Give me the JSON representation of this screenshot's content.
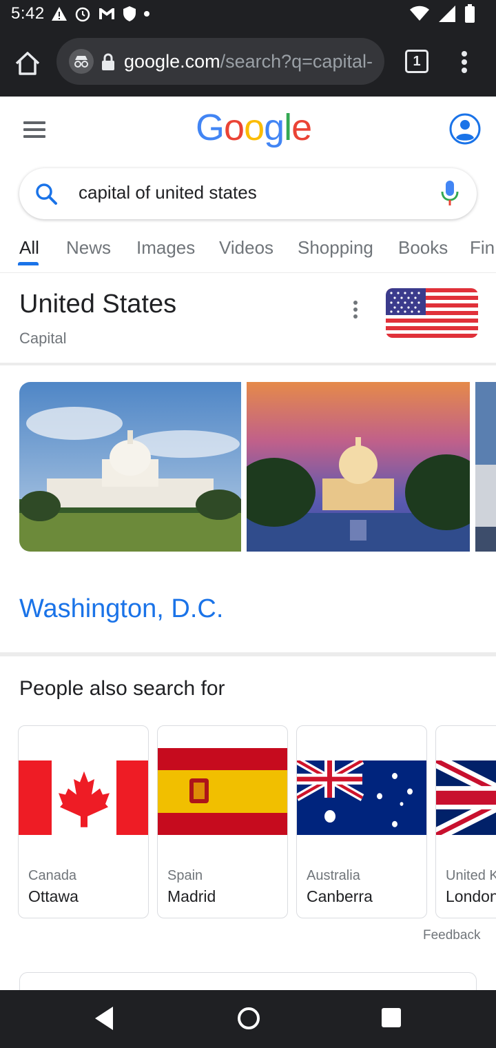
{
  "status_bar": {
    "time": "5:42"
  },
  "browser": {
    "url_main": "google.com",
    "url_path": "/search?q=capital-",
    "tab_count": "1"
  },
  "google": {
    "logo_letters": [
      {
        "ch": "G",
        "color": "#4285F4"
      },
      {
        "ch": "o",
        "color": "#EA4335"
      },
      {
        "ch": "o",
        "color": "#FBBC05"
      },
      {
        "ch": "g",
        "color": "#4285F4"
      },
      {
        "ch": "l",
        "color": "#34A853"
      },
      {
        "ch": "e",
        "color": "#EA4335"
      }
    ],
    "query": "capital of united states"
  },
  "tabs": [
    "All",
    "News",
    "Images",
    "Videos",
    "Shopping",
    "Books",
    "Fin"
  ],
  "knowledge_panel": {
    "title": "United States",
    "subtitle": "Capital",
    "answer": "Washington, D.C."
  },
  "people_also_search": {
    "title": "People also search for",
    "items": [
      {
        "country": "Canada",
        "capital": "Ottawa"
      },
      {
        "country": "Spain",
        "capital": "Madrid"
      },
      {
        "country": "Australia",
        "capital": "Canberra"
      },
      {
        "country": "United K",
        "capital": "London"
      }
    ],
    "feedback": "Feedback"
  },
  "colors": {
    "accent": "#1a73e8",
    "chrome_dark": "#1f2023"
  }
}
